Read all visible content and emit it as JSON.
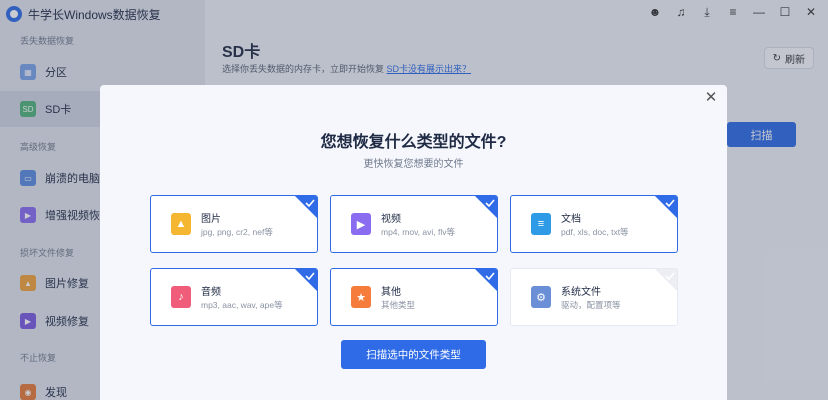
{
  "app": {
    "title": "牛学长Windows数据恢复"
  },
  "sidebar": {
    "sections": [
      {
        "label": "丢失数据恢复"
      },
      {
        "label": "高级恢复"
      },
      {
        "label": "损坏文件修复"
      },
      {
        "label": "不止恢复"
      }
    ],
    "items": [
      {
        "label": "分区",
        "icon": "partition-icon"
      },
      {
        "label": "SD卡",
        "icon": "sd-card-icon"
      },
      {
        "label": "崩溃的电脑",
        "icon": "crashed-pc-icon"
      },
      {
        "label": "增强视频恢复",
        "icon": "enhanced-video-icon"
      },
      {
        "label": "图片修复",
        "icon": "photo-repair-icon"
      },
      {
        "label": "视频修复",
        "icon": "video-repair-icon"
      },
      {
        "label": "发现",
        "icon": "discover-icon"
      }
    ]
  },
  "main": {
    "title": "SD卡",
    "subtitle": "选择你丢失数据的内存卡，立即开始恢复",
    "help_link": "SD卡没有展示出来？",
    "refresh_label": "刷新",
    "scan_label": "扫描"
  },
  "modal": {
    "title": "您想恢复什么类型的文件?",
    "subtitle": "更快恢复您想要的文件",
    "cards": [
      {
        "title": "图片",
        "desc": "jpg, png, cr2, nef等",
        "selected": true,
        "icon": "image-icon",
        "color": "#f5b731"
      },
      {
        "title": "视频",
        "desc": "mp4, mov, avi, flv等",
        "selected": true,
        "icon": "video-icon",
        "color": "#8a6cf0"
      },
      {
        "title": "文档",
        "desc": "pdf, xls, doc, txt等",
        "selected": true,
        "icon": "document-icon",
        "color": "#2f9be6"
      },
      {
        "title": "音频",
        "desc": "mp3, aac, wav, ape等",
        "selected": true,
        "icon": "audio-icon",
        "color": "#ef5d7a"
      },
      {
        "title": "其他",
        "desc": "其他类型",
        "selected": true,
        "icon": "other-icon",
        "color": "#f57c3a"
      },
      {
        "title": "系统文件",
        "desc": "驱动，配置项等",
        "selected": false,
        "icon": "system-file-icon",
        "color": "#6b8fd6"
      }
    ],
    "scan_button": "扫描选中的文件类型"
  }
}
